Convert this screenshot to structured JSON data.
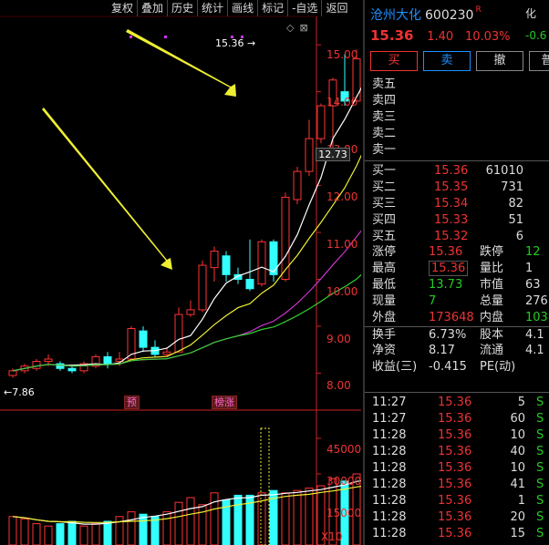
{
  "toolbar": [
    "复权",
    "叠加",
    "历史",
    "统计",
    "画线",
    "标记",
    "-自选",
    "返回"
  ],
  "chart": {
    "price_axis": [
      "15.00",
      "14.00",
      "13.00",
      "12.00",
      "11.00",
      "10.00",
      "9.00",
      "8.00"
    ],
    "volume_axis": [
      "45000",
      "30000",
      "15000"
    ],
    "volume_unit": "X10",
    "current_price_tag": "12.73",
    "high_callout": "15.36",
    "low_callout": "7.86",
    "tag_pre": "预",
    "tag_limit": "榜涨"
  },
  "chart_data": {
    "type": "candlestick",
    "ylim": [
      7.6,
      15.8
    ],
    "candles": [
      [
        7.95,
        8.05,
        7.9,
        8.1
      ],
      [
        8.05,
        8.15,
        8.0,
        8.2
      ],
      [
        8.1,
        8.25,
        8.05,
        8.3
      ],
      [
        8.25,
        8.3,
        8.15,
        8.4
      ],
      [
        8.2,
        8.1,
        8.05,
        8.25
      ],
      [
        8.1,
        8.05,
        8.0,
        8.15
      ],
      [
        8.05,
        8.2,
        8.0,
        8.25
      ],
      [
        8.15,
        8.35,
        8.1,
        8.4
      ],
      [
        8.35,
        8.2,
        8.1,
        8.45
      ],
      [
        8.25,
        8.3,
        8.15,
        8.45
      ],
      [
        8.3,
        8.95,
        8.3,
        9.0
      ],
      [
        8.9,
        8.55,
        8.45,
        9.0
      ],
      [
        8.55,
        8.4,
        8.35,
        8.7
      ],
      [
        8.4,
        8.45,
        8.35,
        8.55
      ],
      [
        8.45,
        9.25,
        8.45,
        9.4
      ],
      [
        9.25,
        9.35,
        9.2,
        9.55
      ],
      [
        9.35,
        10.3,
        9.3,
        10.4
      ],
      [
        10.25,
        10.6,
        9.95,
        10.7
      ],
      [
        10.5,
        10.1,
        9.95,
        10.6
      ],
      [
        10.1,
        10.0,
        9.9,
        10.25
      ],
      [
        10.0,
        9.8,
        9.75,
        10.85
      ],
      [
        9.9,
        10.8,
        9.85,
        10.85
      ],
      [
        10.8,
        10.1,
        9.95,
        10.85
      ],
      [
        10.0,
        11.75,
        9.95,
        11.85
      ],
      [
        11.7,
        12.3,
        11.6,
        12.4
      ],
      [
        12.3,
        13.0,
        12.2,
        13.4
      ],
      [
        13.0,
        13.7,
        12.9,
        13.75
      ],
      [
        13.7,
        14.25,
        12.8,
        14.3
      ],
      [
        14.0,
        13.8,
        13.7,
        14.8
      ],
      [
        13.8,
        14.7,
        13.75,
        14.9
      ],
      [
        13.73,
        15.36,
        13.73,
        15.36
      ]
    ],
    "volume": [
      12000,
      11000,
      9000,
      8000,
      9000,
      10000,
      8000,
      9000,
      10000,
      12000,
      14000,
      13000,
      12000,
      14000,
      18000,
      20000,
      17000,
      22000,
      19000,
      21000,
      21000,
      22000,
      23000,
      22000,
      23000,
      24000,
      25000,
      28000,
      27000,
      30000,
      28000
    ]
  },
  "quote": {
    "name": "沧州大化",
    "code": "600230",
    "r_badge": "R",
    "price": "15.36",
    "change": "1.40",
    "pct": "10.03%",
    "ext1": "化",
    "ext2": "-0.6",
    "btn_buy": "买",
    "btn_sell": "卖",
    "btn_cancel": "撤",
    "btn_more": "普",
    "asks": [
      {
        "label": "卖五",
        "price": "",
        "vol": ""
      },
      {
        "label": "卖四",
        "price": "",
        "vol": ""
      },
      {
        "label": "卖三",
        "price": "",
        "vol": ""
      },
      {
        "label": "卖二",
        "price": "",
        "vol": ""
      },
      {
        "label": "卖一",
        "price": "",
        "vol": ""
      }
    ],
    "bids": [
      {
        "label": "买一",
        "price": "15.36",
        "vol": "61010"
      },
      {
        "label": "买二",
        "price": "15.35",
        "vol": "731"
      },
      {
        "label": "买三",
        "price": "15.34",
        "vol": "82"
      },
      {
        "label": "买四",
        "price": "15.33",
        "vol": "51"
      },
      {
        "label": "买五",
        "price": "15.32",
        "vol": "6"
      }
    ],
    "stats": [
      [
        {
          "k": "涨停",
          "v": "15.36"
        },
        {
          "k": "跌停",
          "v": "12"
        }
      ],
      [
        {
          "k": "最高",
          "v": "15.36"
        },
        {
          "k": "量比",
          "v": "1"
        }
      ],
      [
        {
          "k": "最低",
          "v": "13.73"
        },
        {
          "k": "市值",
          "v": "63"
        }
      ],
      [
        {
          "k": "现量",
          "v": "7"
        },
        {
          "k": "总量",
          "v": "276"
        }
      ],
      [
        {
          "k": "外盘",
          "v": "173648"
        },
        {
          "k": "内盘",
          "v": "103"
        }
      ],
      [
        {
          "k": "换手",
          "v": "6.73%"
        },
        {
          "k": "股本",
          "v": "4.1"
        }
      ],
      [
        {
          "k": "净资",
          "v": "8.17"
        },
        {
          "k": "流通",
          "v": "4.1"
        }
      ],
      [
        {
          "k": "收益(三)",
          "v": "-0.415"
        },
        {
          "k": "PE(动)",
          "v": ""
        }
      ]
    ],
    "ticks": [
      {
        "t": "11:27",
        "p": "15.36",
        "v": "5",
        "s": "S"
      },
      {
        "t": "11:27",
        "p": "15.36",
        "v": "60",
        "s": "S"
      },
      {
        "t": "11:28",
        "p": "15.36",
        "v": "10",
        "s": "S"
      },
      {
        "t": "11:28",
        "p": "15.36",
        "v": "40",
        "s": "S"
      },
      {
        "t": "11:28",
        "p": "15.36",
        "v": "10",
        "s": "S"
      },
      {
        "t": "11:28",
        "p": "15.36",
        "v": "41",
        "s": "S"
      },
      {
        "t": "11:28",
        "p": "15.36",
        "v": "1",
        "s": "S"
      },
      {
        "t": "11:28",
        "p": "15.36",
        "v": "20",
        "s": "S"
      },
      {
        "t": "11:28",
        "p": "15.36",
        "v": "15",
        "s": "S"
      }
    ]
  }
}
